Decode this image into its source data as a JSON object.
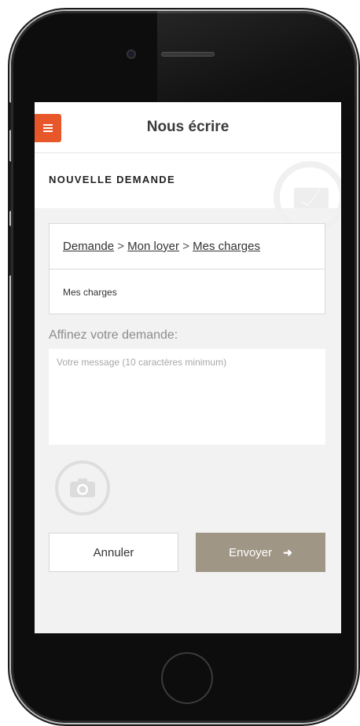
{
  "header": {
    "title": "Nous écrire",
    "menu_icon": "hamburger-icon",
    "accent_color": "#e8572a"
  },
  "section": {
    "title": "NOUVELLE DEMANDE",
    "icon": "envelope-icon"
  },
  "breadcrumb": {
    "items": [
      "Demande",
      "Mon loyer",
      "Mes charges"
    ],
    "separator": ">"
  },
  "selected_category": "Mes charges",
  "refine": {
    "label": "Affinez votre demande:",
    "placeholder": "Votre message (10 caractères minimum)",
    "value": ""
  },
  "attachment": {
    "icon": "camera-icon"
  },
  "actions": {
    "cancel_label": "Annuler",
    "send_label": "Envoyer",
    "send_icon": "arrow-right-icon",
    "send_color": "#a09686"
  }
}
